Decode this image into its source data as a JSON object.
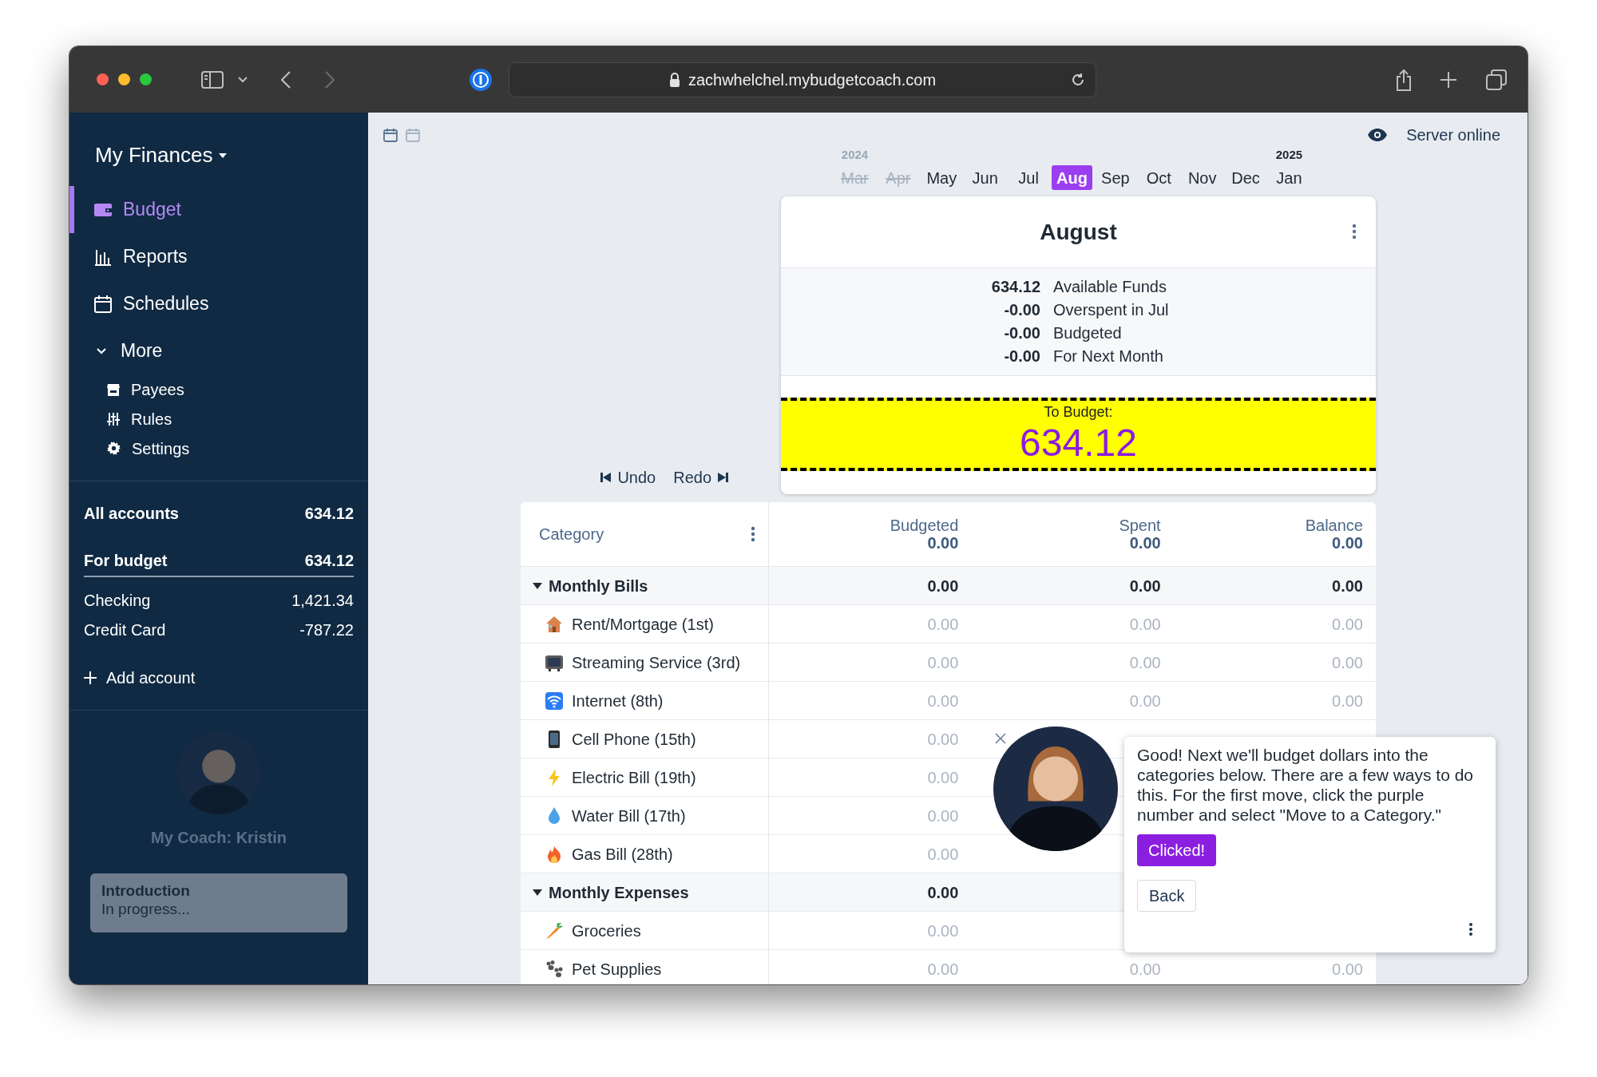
{
  "browser": {
    "url": "zachwhelchel.mybudgetcoach.com"
  },
  "sidebar": {
    "title": "My Finances",
    "nav": [
      {
        "label": "Budget",
        "selected": true
      },
      {
        "label": "Reports",
        "selected": false
      },
      {
        "label": "Schedules",
        "selected": false
      }
    ],
    "more": {
      "label": "More",
      "expanded": true,
      "items": [
        {
          "label": "Payees"
        },
        {
          "label": "Rules"
        },
        {
          "label": "Settings"
        }
      ]
    },
    "account_totals": [
      {
        "label": "All accounts",
        "amount": "634.12"
      },
      {
        "label": "For budget",
        "amount": "634.12"
      }
    ],
    "accounts": [
      {
        "name": "Checking",
        "balance": "1,421.34"
      },
      {
        "name": "Credit Card",
        "balance": "-787.22"
      }
    ],
    "add_account": "Add account",
    "coach": "My Coach: Kristin",
    "progress": {
      "title": "Introduction",
      "status": "In progress..."
    }
  },
  "status": "Server online",
  "months": [
    {
      "label": "Mar",
      "year": "2024",
      "past": true,
      "selected": false
    },
    {
      "label": "Apr",
      "past": true,
      "selected": false
    },
    {
      "label": "May",
      "past": false,
      "selected": false
    },
    {
      "label": "Jun",
      "past": false,
      "selected": false
    },
    {
      "label": "Jul",
      "past": false,
      "selected": false
    },
    {
      "label": "Aug",
      "past": false,
      "selected": true
    },
    {
      "label": "Sep",
      "past": false,
      "selected": false
    },
    {
      "label": "Oct",
      "past": false,
      "selected": false
    },
    {
      "label": "Nov",
      "past": false,
      "selected": false
    },
    {
      "label": "Dec",
      "past": false,
      "selected": false
    },
    {
      "label": "Jan",
      "year": "2025",
      "past": false,
      "selected": false
    }
  ],
  "month_summary": {
    "title": "August",
    "lines": [
      {
        "amount": "634.12",
        "label": "Available Funds"
      },
      {
        "amount": "-0.00",
        "label": "Overspent in Jul"
      },
      {
        "amount": "-0.00",
        "label": "Budgeted"
      },
      {
        "amount": "-0.00",
        "label": "For Next Month"
      }
    ],
    "to_budget": {
      "label": "To Budget:",
      "amount": "634.12"
    }
  },
  "history": {
    "undo": "Undo",
    "redo": "Redo"
  },
  "table": {
    "columns": [
      {
        "label": "Category"
      },
      {
        "label": "Budgeted",
        "total": "0.00"
      },
      {
        "label": "Spent",
        "total": "0.00"
      },
      {
        "label": "Balance",
        "total": "0.00"
      }
    ],
    "groups": [
      {
        "name": "Monthly Bills",
        "expanded": true,
        "budgeted": "0.00",
        "spent": "0.00",
        "balance": "0.00",
        "children": [
          {
            "name": "Rent/Mortgage (1st)",
            "budgeted": "0.00",
            "spent": "0.00",
            "balance": "0.00"
          },
          {
            "name": "Streaming Service (3rd)",
            "budgeted": "0.00",
            "spent": "0.00",
            "balance": "0.00"
          },
          {
            "name": "Internet (8th)",
            "budgeted": "0.00",
            "spent": "0.00",
            "balance": "0.00"
          },
          {
            "name": "Cell Phone (15th)",
            "budgeted": "0.00"
          },
          {
            "name": "Electric Bill (19th)",
            "budgeted": "0.00"
          },
          {
            "name": "Water Bill (17th)",
            "budgeted": "0.00"
          },
          {
            "name": "Gas Bill (28th)",
            "budgeted": "0.00"
          }
        ]
      },
      {
        "name": "Monthly Expenses",
        "expanded": true,
        "budgeted": "0.00",
        "children": [
          {
            "name": "Groceries",
            "budgeted": "0.00"
          },
          {
            "name": "Pet Supplies",
            "budgeted": "0.00",
            "spent": "0.00",
            "balance": "0.00"
          }
        ]
      }
    ]
  },
  "tutorial": {
    "message": "Good! Next we'll budget dollars into the categories below. There are a few ways to do this. For the first move, click the purple number and select \"Move to a Category.\"",
    "buttons": [
      {
        "label": "Clicked!",
        "kind": "primary"
      },
      {
        "label": "Back",
        "kind": "secondary"
      }
    ]
  }
}
